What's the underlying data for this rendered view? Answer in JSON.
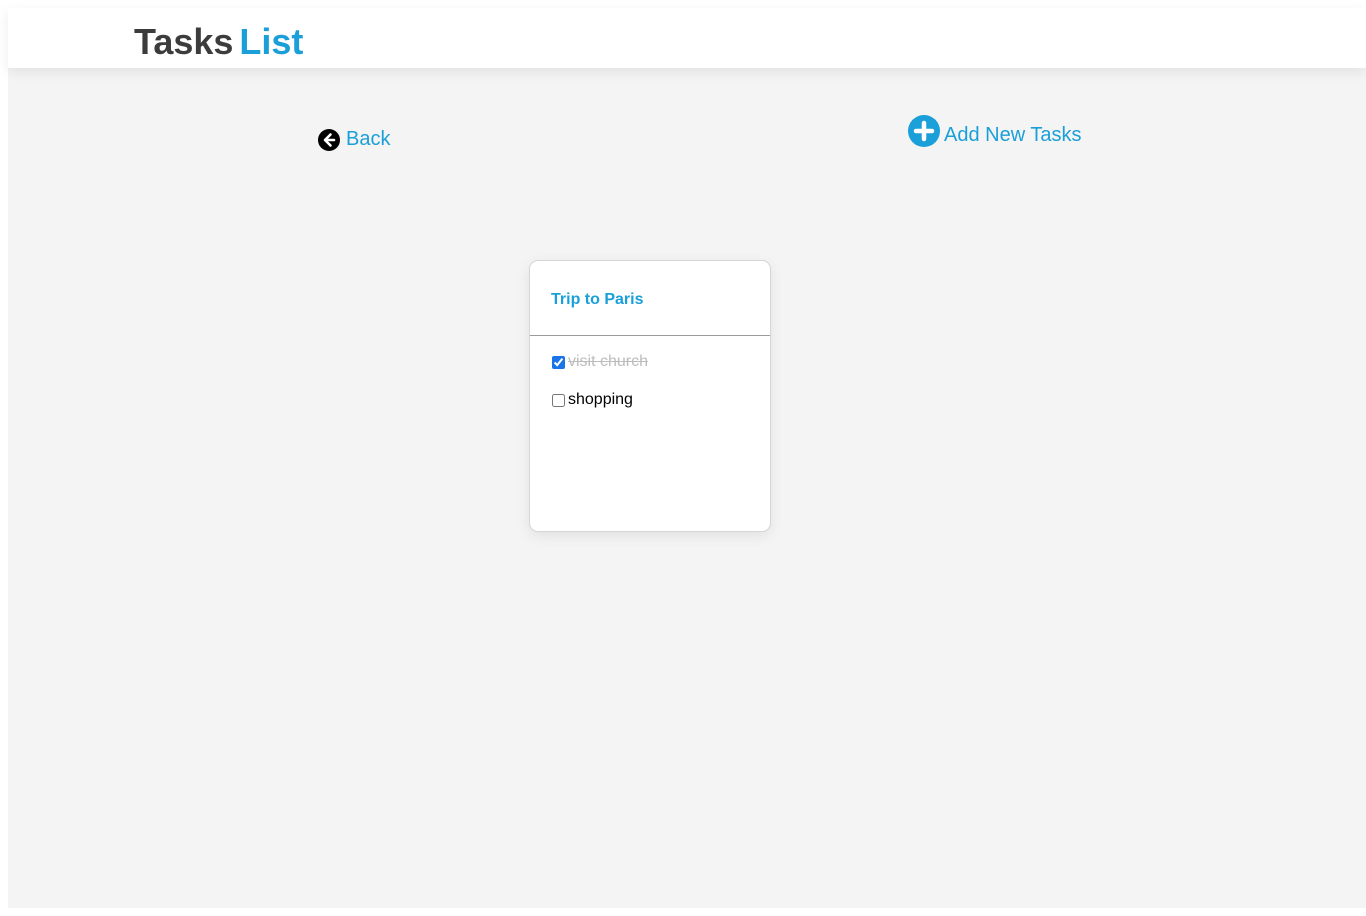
{
  "header": {
    "title_part1": "Tasks",
    "title_part2": "List"
  },
  "nav": {
    "back_label": "Back",
    "back_icon": "arrow-circle-left-icon",
    "add_label": "Add New Tasks",
    "add_icon": "plus-circle-icon"
  },
  "card": {
    "title": "Trip to Paris",
    "tasks": [
      {
        "label": "visit church",
        "done": true
      },
      {
        "label": "shopping",
        "done": false
      }
    ]
  },
  "colors": {
    "accent": "#1a9fd8",
    "brand_dark": "#3c3c3c",
    "page_bg": "#f4f4f4",
    "done_text": "#bdbdbd"
  }
}
